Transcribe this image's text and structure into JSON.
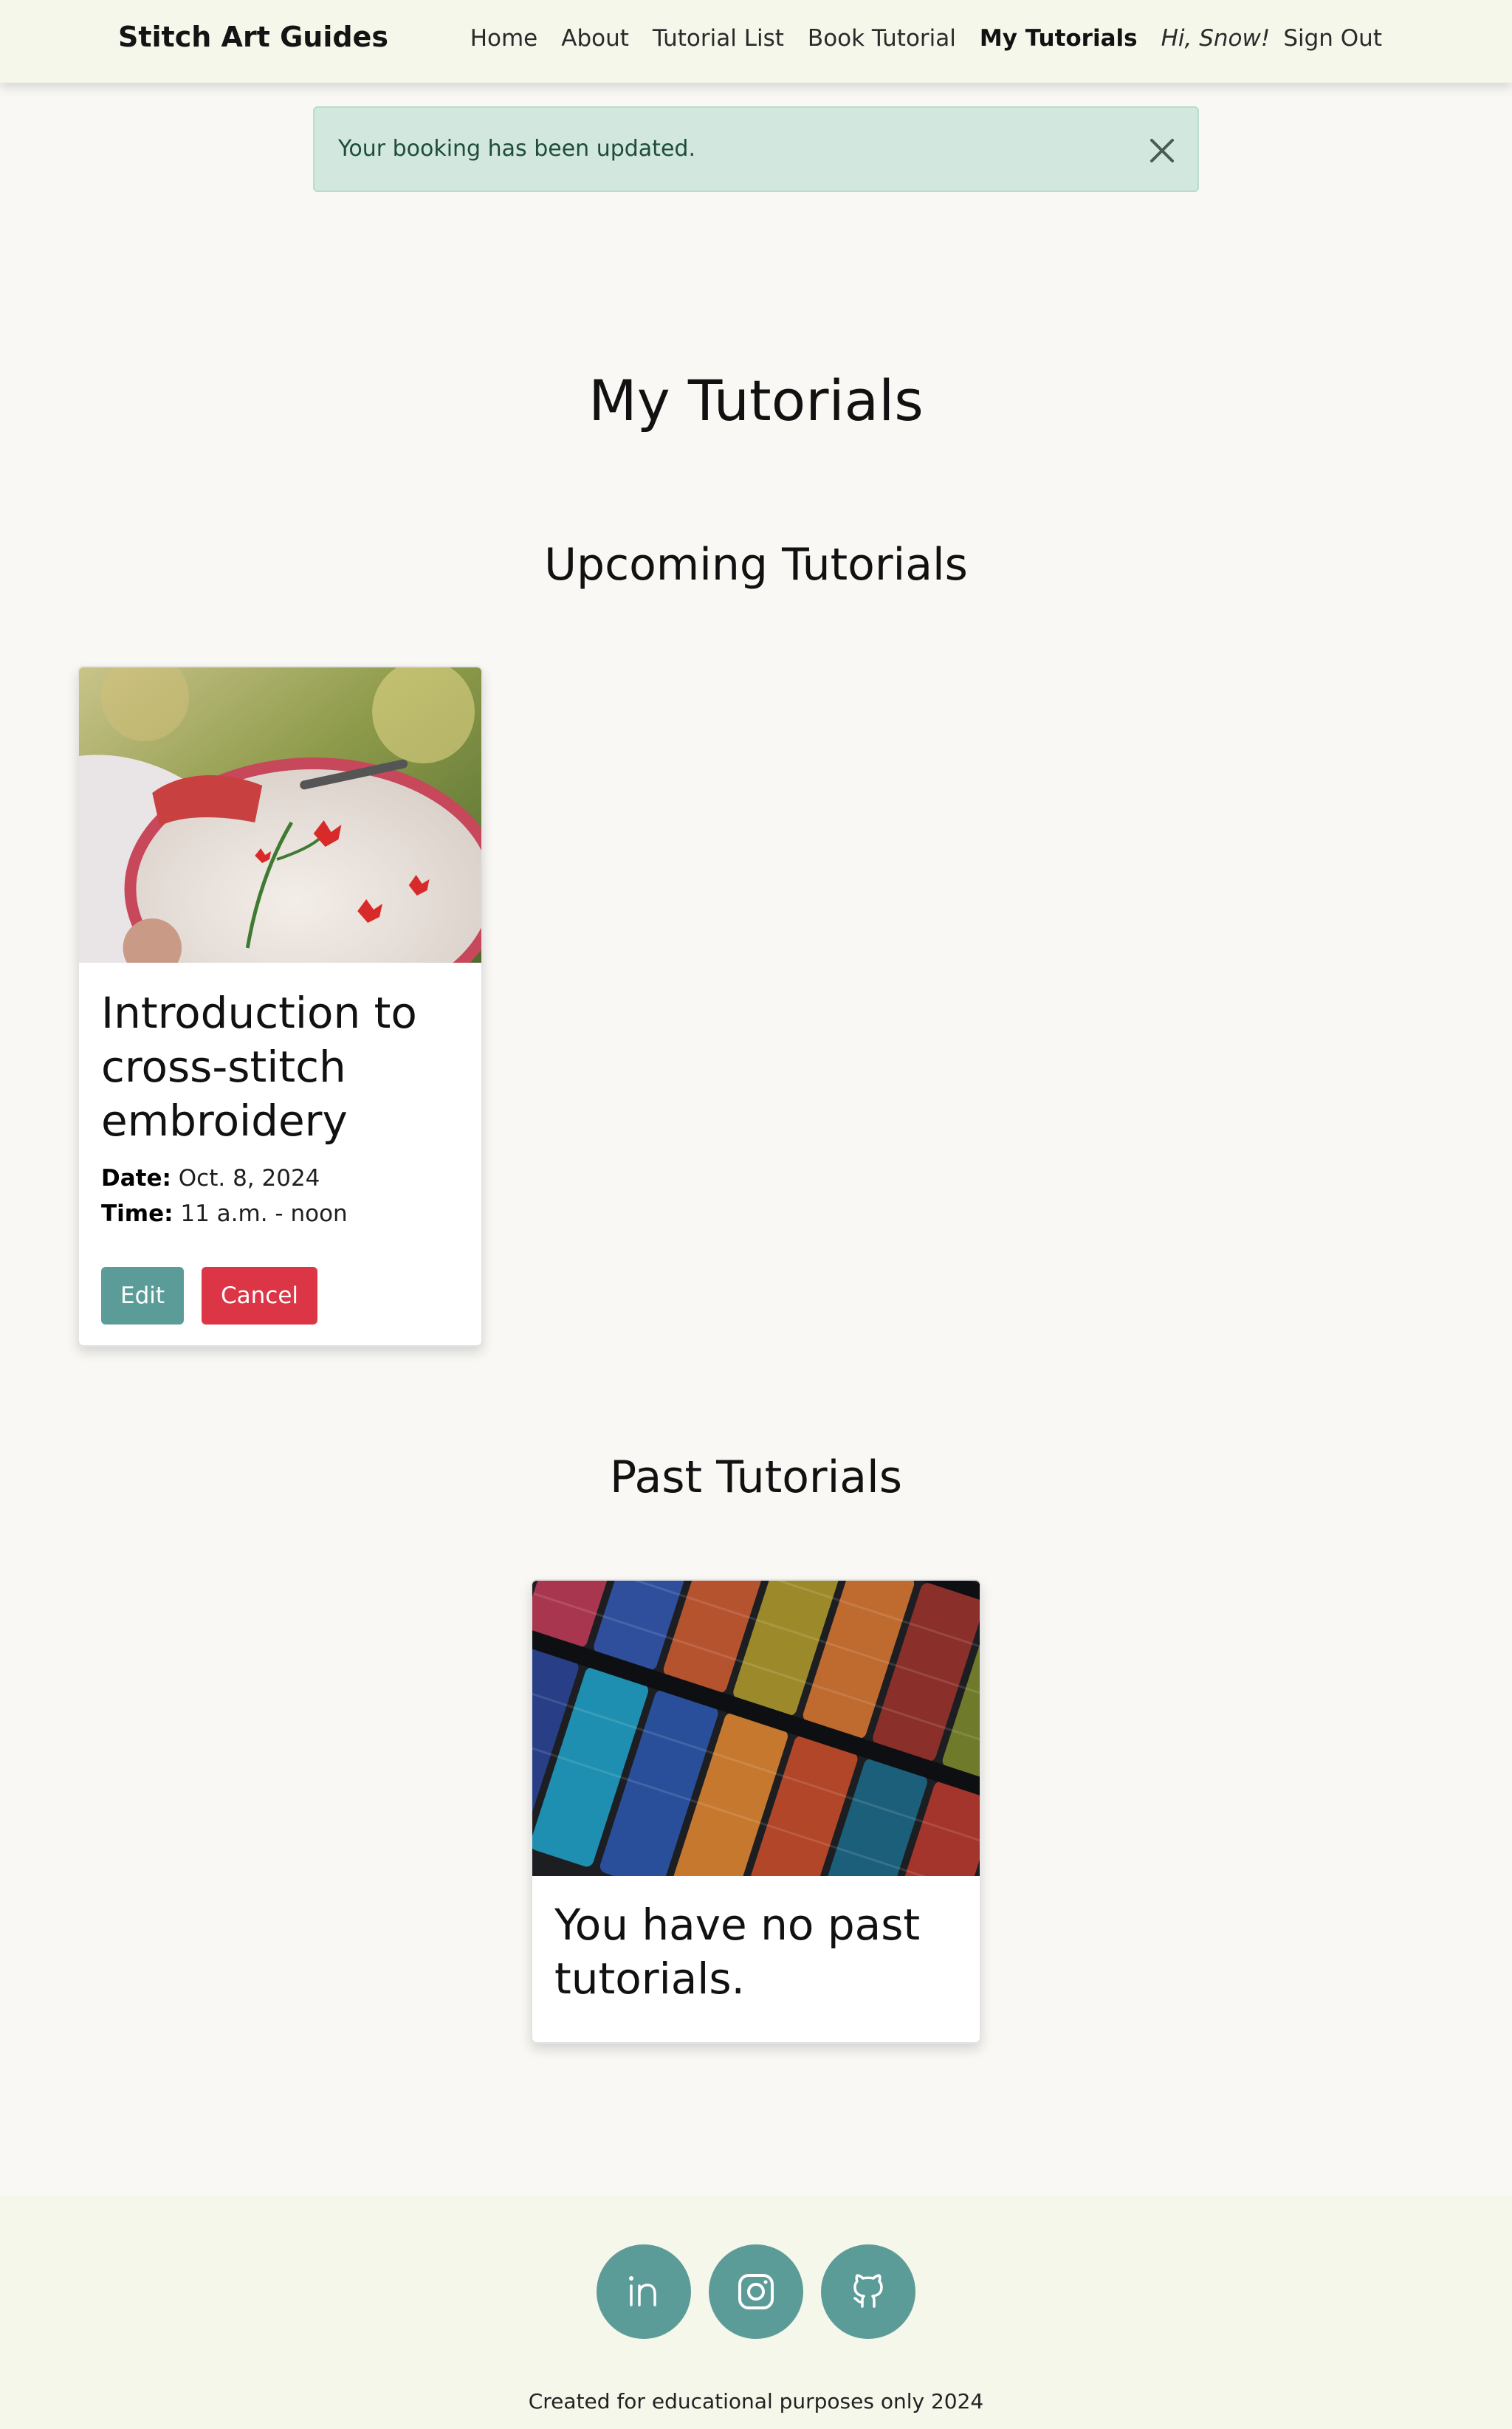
{
  "navbar": {
    "brand": "Stitch Art Guides",
    "links": [
      "Home",
      "About",
      "Tutorial List",
      "Book Tutorial",
      "My Tutorials"
    ],
    "active": "My Tutorials",
    "greeting": "Hi, Snow!",
    "sign_out": "Sign Out"
  },
  "alert": {
    "message": "Your booking has been updated."
  },
  "page": {
    "title": "My Tutorials"
  },
  "upcoming": {
    "heading": "Upcoming Tutorials",
    "cards": [
      {
        "title": "Introduction to cross-stitch embroidery",
        "date_label": "Date:",
        "date": "Oct. 8, 2024",
        "time_label": "Time:",
        "time": "11 a.m. - noon",
        "edit_label": "Edit",
        "cancel_label": "Cancel"
      }
    ]
  },
  "past": {
    "heading": "Past Tutorials",
    "empty_message": "You have no past tutorials."
  },
  "footer": {
    "social": [
      "linkedin-icon",
      "instagram-icon",
      "github-icon"
    ],
    "text": "Created for educational purposes only 2024"
  },
  "colors": {
    "brand_teal": "#5c9c98",
    "danger": "#dc3545",
    "navbar_bg": "#f4f7ea",
    "alert_bg": "#d2e7de"
  }
}
